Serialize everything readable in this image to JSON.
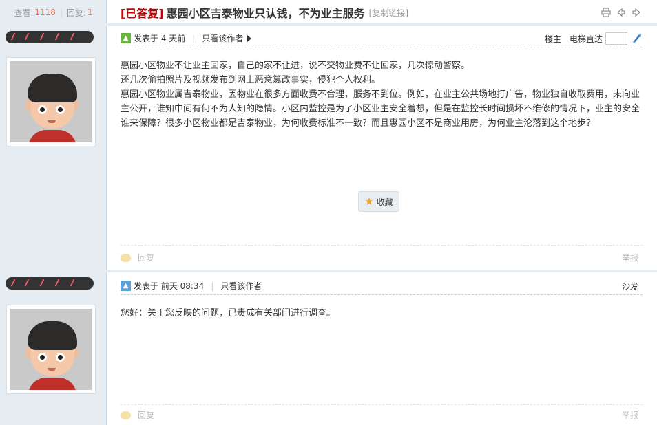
{
  "header": {
    "views_label": "查看:",
    "views": "1118",
    "replies_label": "回复:",
    "replies": "1",
    "status_tag": "[已答复]",
    "title": "惠园小区吉泰物业只认钱，不为业主服务",
    "copy_link": "[复制链接]",
    "icons": [
      "print-icon",
      "prev-thread-icon",
      "next-thread-icon"
    ]
  },
  "posts": [
    {
      "posted_label": "发表于 4 天前",
      "only_author": "只看该作者",
      "floor": "楼主",
      "jump_label": "电梯直达",
      "jump_value": "",
      "body": [
        "惠园小区物业不让业主回家，自己的家不让进，说不交物业费不让回家，几次惊动警察。",
        "还几次偷拍照片及视频发布到网上恶意篡改事实，侵犯个人权利。",
        "惠园小区物业属吉泰物业，因物业在很多方面收费不合理，服务不到位。例如，在业主公共场地打广告，物业独自收取费用，未向业主公开，谁知中间有何不为人知的隐情。小区内监控是为了小区业主安全着想，但是在监控长时间损坏不维修的情况下，业主的安全谁来保障？很多小区物业都是吉泰物业，为何收费标准不一致？而且惠园小区不是商业用房，为何业主沦落到这个地步？"
      ],
      "favorite": "收藏",
      "reply": "回复",
      "report": "举报"
    },
    {
      "posted_label": "发表于 前天 08:34",
      "only_author": "只看该作者",
      "floor": "沙发",
      "body": [
        "您好：关于您反映的问题，已责成有关部门进行调查。"
      ],
      "reply": "回复",
      "report": "举报"
    }
  ]
}
